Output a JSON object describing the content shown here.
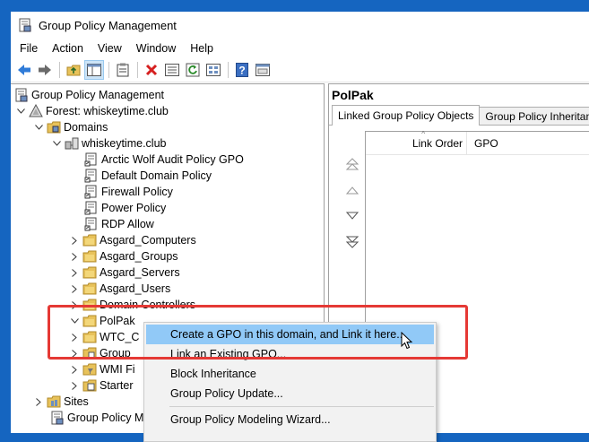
{
  "window": {
    "title": "Group Policy Management"
  },
  "menubar": [
    "File",
    "Action",
    "View",
    "Window",
    "Help"
  ],
  "toolbar": [
    "back-icon",
    "forward-icon",
    "up-folder-icon",
    "show-tree-icon",
    "properties-icon",
    "delete-icon",
    "details-icon",
    "refresh-icon",
    "help-icon",
    "console-icon"
  ],
  "tree": {
    "root": "Group Policy Management",
    "forest": "Forest: whiskeytime.club",
    "domains": "Domains",
    "domain": "whiskeytime.club",
    "gpos": [
      "Arctic Wolf Audit Policy GPO",
      "Default Domain Policy",
      "Firewall Policy",
      "Power Policy",
      "RDP Allow"
    ],
    "ous": [
      "Asgard_Computers",
      "Asgard_Groups",
      "Asgard_Servers",
      "Asgard_Users",
      "Domain Controllers",
      "PolPak",
      "WTC_C",
      "Group",
      "WMI Fi",
      "Starter"
    ],
    "sites": "Sites",
    "modeling": "Group Policy M"
  },
  "right": {
    "title": "PolPak",
    "tabs": [
      "Linked Group Policy Objects",
      "Group Policy Inheritance"
    ],
    "columns": [
      "Link Order",
      "GPO"
    ]
  },
  "context_menu": {
    "items": [
      "Create a GPO in this domain, and Link it here...",
      "Link an Existing GPO...",
      "Block Inheritance",
      "Group Policy Update...",
      "Group Policy Modeling Wizard..."
    ]
  },
  "colors": {
    "background": "#1565c0",
    "highlight": "#91c9f7",
    "annotation": "#e53935"
  }
}
